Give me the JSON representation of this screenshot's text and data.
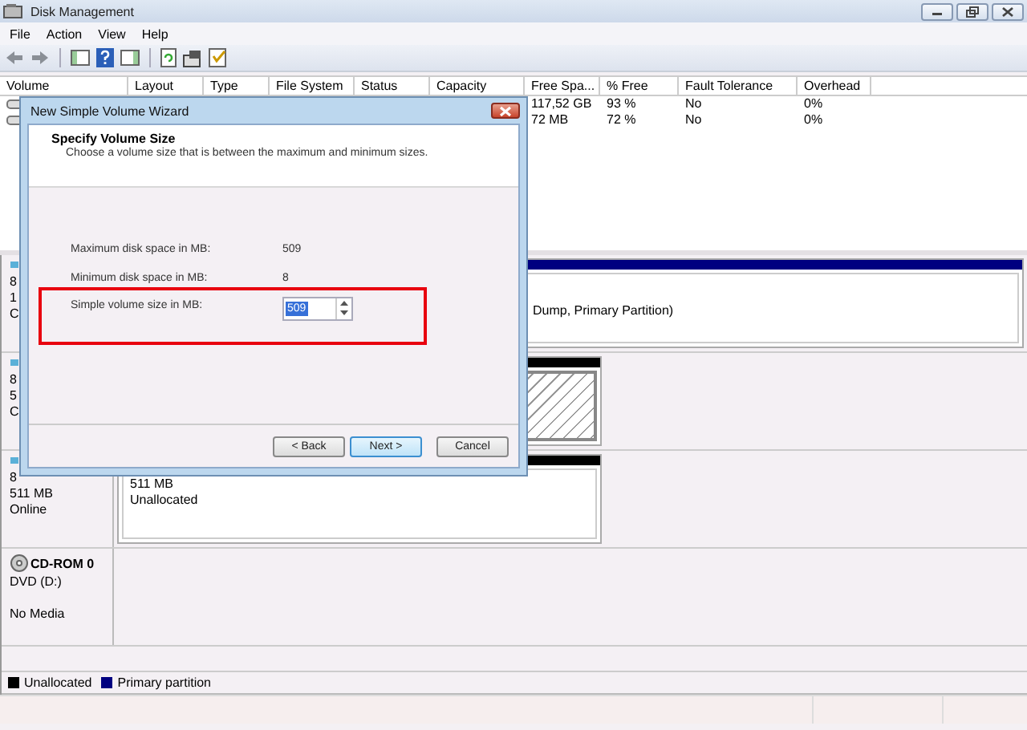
{
  "window": {
    "title": "Disk Management"
  },
  "menu": [
    {
      "label": "File"
    },
    {
      "label": "Action"
    },
    {
      "label": "View"
    },
    {
      "label": "Help"
    }
  ],
  "volume_table": {
    "columns": [
      "Volume",
      "Layout",
      "Type",
      "File System",
      "Status",
      "Capacity",
      "Free Spa...",
      "% Free",
      "Fault Tolerance",
      "Overhead"
    ],
    "rows": [
      {
        "free_space": "117,52 GB",
        "percent_free": "93 %",
        "fault_tolerance": "No",
        "overhead": "0%"
      },
      {
        "free_space": "72 MB",
        "percent_free": "72 %",
        "fault_tolerance": "No",
        "overhead": "0%"
      }
    ]
  },
  "disks": [
    {
      "kind": "disk",
      "label_lines": [
        "8",
        "1",
        "C"
      ],
      "partition": {
        "kind": "primary",
        "selected": false,
        "lines": [
          "Dump, Primary Partition)"
        ]
      }
    },
    {
      "kind": "disk",
      "label_lines": [
        "8",
        "5",
        "C"
      ],
      "partition": {
        "kind": "unallocated",
        "selected": true
      }
    },
    {
      "kind": "disk",
      "label_lines": [
        "8",
        "511 MB",
        "Online"
      ],
      "partition": {
        "kind": "unallocated",
        "selected": false,
        "lines": [
          "511 MB",
          "Unallocated"
        ]
      }
    },
    {
      "kind": "cdrom",
      "name": "CD-ROM 0",
      "label_lines": [
        "DVD (D:)",
        "No Media"
      ]
    }
  ],
  "legend": [
    {
      "label": "Unallocated",
      "color": "#000000"
    },
    {
      "label": "Primary partition",
      "color": "#000080"
    }
  ],
  "dialog": {
    "title": "New Simple Volume Wizard",
    "heading": "Specify Volume Size",
    "subtitle": "Choose a volume size that is between the maximum and minimum sizes.",
    "fields": [
      {
        "label": "Maximum disk space in MB:",
        "value": "509"
      },
      {
        "label": "Minimum disk space in MB:",
        "value": "8"
      }
    ],
    "size_field": {
      "label": "Simple volume size in MB:",
      "value": "509",
      "text_selected": true
    },
    "buttons": [
      {
        "label": "< Back",
        "default": false
      },
      {
        "label": "Next >",
        "default": true
      },
      {
        "label": "Cancel",
        "default": false
      }
    ]
  }
}
